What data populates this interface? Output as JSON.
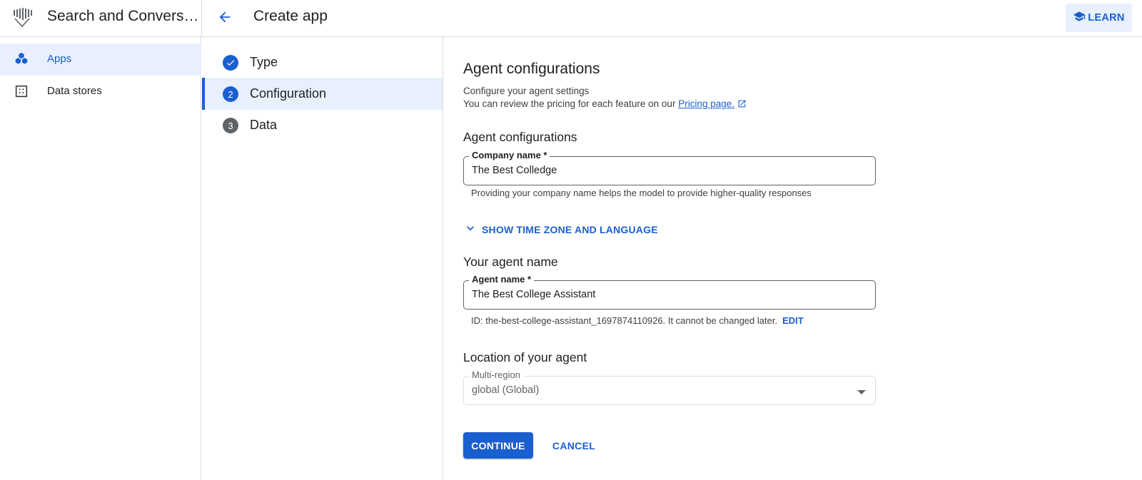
{
  "header": {
    "app_title": "Search and Conversation",
    "page_title": "Create app",
    "learn_label": "LEARN",
    "back_icon": "arrow-back-icon",
    "learn_icon": "school-icon"
  },
  "sidebar": {
    "items": [
      {
        "label": "Apps",
        "icon": "apps-cubes-icon",
        "active": true
      },
      {
        "label": "Data stores",
        "icon": "data-store-grid-icon",
        "active": false
      }
    ]
  },
  "stepper": {
    "steps": [
      {
        "label": "Type",
        "state": "done",
        "number": "1"
      },
      {
        "label": "Configuration",
        "state": "current",
        "number": "2"
      },
      {
        "label": "Data",
        "state": "pending",
        "number": "3"
      }
    ]
  },
  "main": {
    "heading": "Agent configurations",
    "subtitle": "Configure your agent settings",
    "pricing_text": "You can review the pricing for each feature on our ",
    "pricing_link": "Pricing page.",
    "section_agent_config": "Agent configurations",
    "company_field": {
      "label": "Company name *",
      "value": "The Best Colledge",
      "helper": "Providing your company name helps the model to provide higher-quality responses"
    },
    "show_tz_label": "SHOW TIME ZONE AND LANGUAGE",
    "section_agent_name": "Your agent name",
    "agent_field": {
      "label": "Agent name *",
      "value": "The Best College Assistant",
      "id_text": "ID: the-best-college-assistant_1697874110926. It cannot be changed later.",
      "edit_label": "EDIT"
    },
    "section_location": "Location of your agent",
    "location_field": {
      "label": "Multi-region",
      "value": "global (Global)"
    },
    "continue_label": "CONTINUE",
    "cancel_label": "CANCEL"
  },
  "colors": {
    "accent": "#1a5fd0",
    "active_bg": "#e8f0fe",
    "divider": "#dadce0",
    "muted": "#5f6368"
  }
}
